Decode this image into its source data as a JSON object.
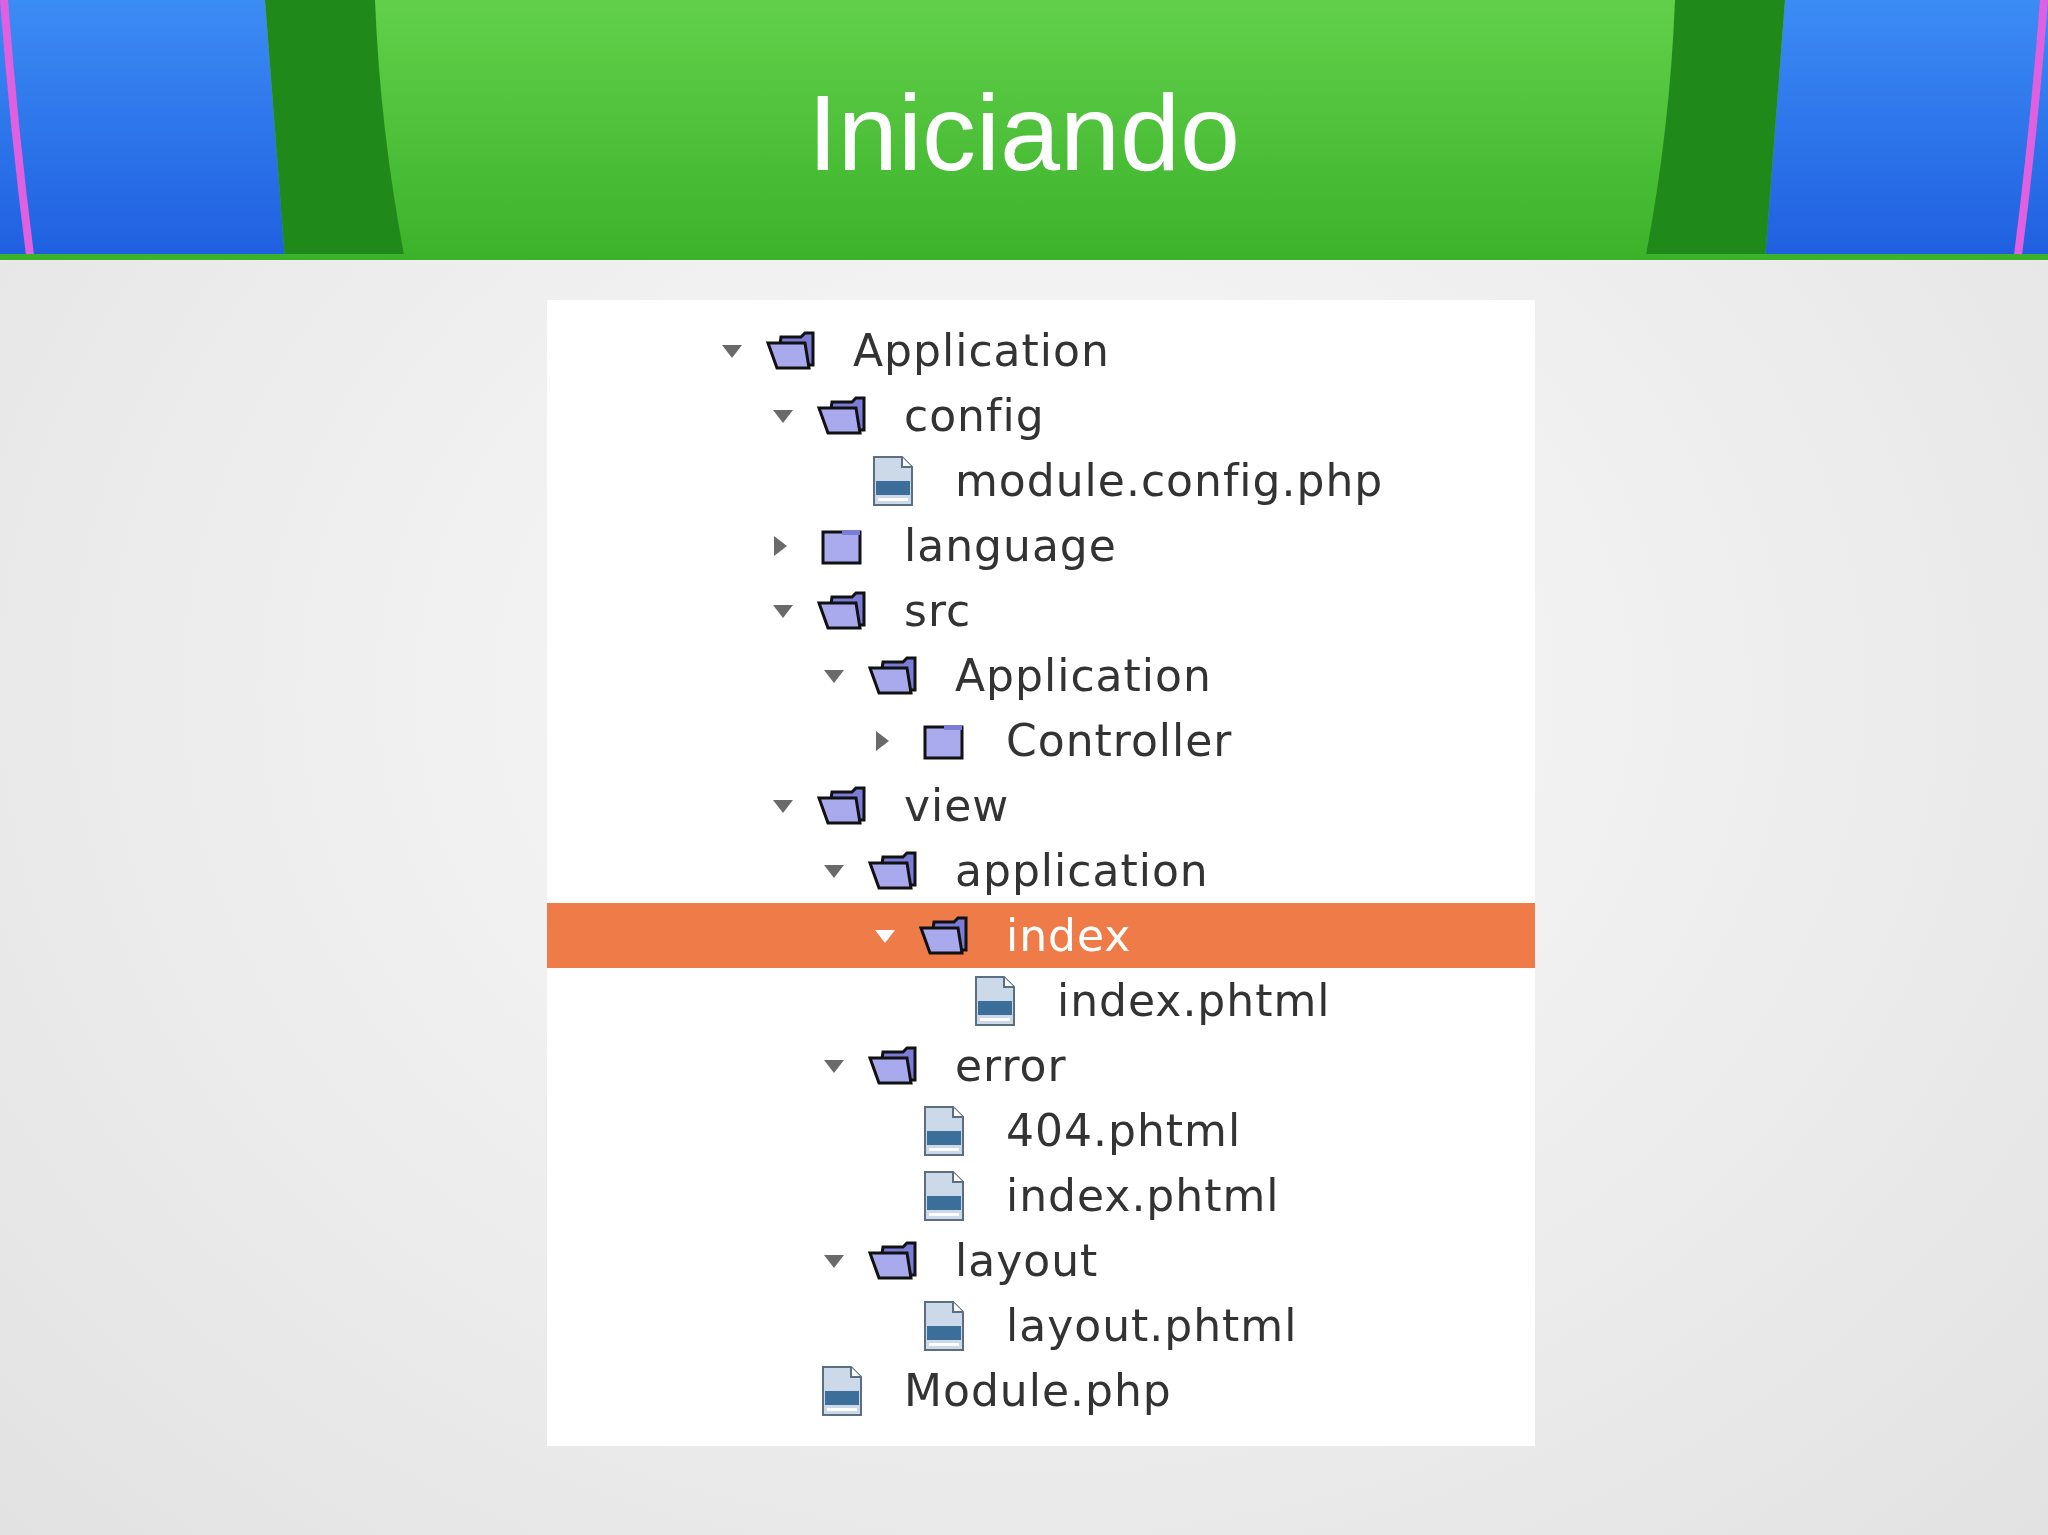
{
  "slide": {
    "title": "Iniciando"
  },
  "tree": [
    {
      "label": "Application",
      "kind": "folder",
      "expanded": true,
      "selected": false,
      "children": [
        {
          "label": "config",
          "kind": "folder",
          "expanded": true,
          "selected": false,
          "children": [
            {
              "label": "module.config.php",
              "kind": "file",
              "selected": false
            }
          ]
        },
        {
          "label": "language",
          "kind": "folder",
          "expanded": false,
          "selected": false
        },
        {
          "label": "src",
          "kind": "folder",
          "expanded": true,
          "selected": false,
          "children": [
            {
              "label": "Application",
              "kind": "folder",
              "expanded": true,
              "selected": false,
              "children": [
                {
                  "label": "Controller",
                  "kind": "folder",
                  "expanded": false,
                  "selected": false
                }
              ]
            }
          ]
        },
        {
          "label": "view",
          "kind": "folder",
          "expanded": true,
          "selected": false,
          "children": [
            {
              "label": "application",
              "kind": "folder",
              "expanded": true,
              "selected": false,
              "children": [
                {
                  "label": "index",
                  "kind": "folder",
                  "expanded": true,
                  "selected": true,
                  "children": [
                    {
                      "label": "index.phtml",
                      "kind": "file",
                      "selected": false
                    }
                  ]
                }
              ]
            },
            {
              "label": "error",
              "kind": "folder",
              "expanded": true,
              "selected": false,
              "children": [
                {
                  "label": "404.phtml",
                  "kind": "file",
                  "selected": false
                },
                {
                  "label": "index.phtml",
                  "kind": "file",
                  "selected": false
                }
              ]
            },
            {
              "label": "layout",
              "kind": "folder",
              "expanded": true,
              "selected": false,
              "children": [
                {
                  "label": "layout.phtml",
                  "kind": "file",
                  "selected": false
                }
              ]
            }
          ]
        },
        {
          "label": "Module.php",
          "kind": "file",
          "selected": false
        }
      ]
    }
  ]
}
